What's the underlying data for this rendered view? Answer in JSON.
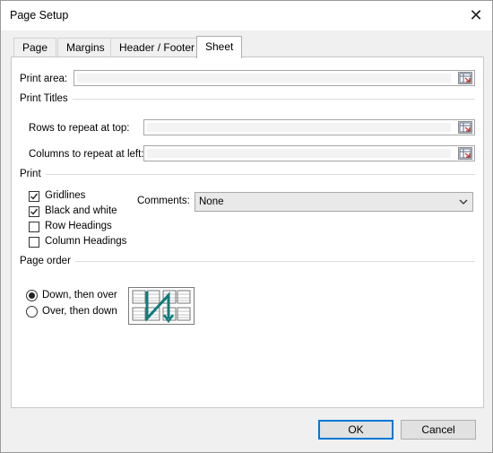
{
  "window": {
    "title": "Page Setup",
    "close_glyph": "✕"
  },
  "tabs": [
    {
      "label": "Page",
      "active": false
    },
    {
      "label": "Margins",
      "active": false
    },
    {
      "label": "Header / Footer",
      "active": false
    },
    {
      "label": "Sheet",
      "active": true
    }
  ],
  "sheet": {
    "print_area_label": "Print area:",
    "print_area_value": "",
    "print_titles_label": "Print Titles",
    "rows_repeat_label": "Rows to repeat at top:",
    "rows_repeat_value": "",
    "cols_repeat_label": "Columns to repeat at left:",
    "cols_repeat_value": "",
    "print_label": "Print",
    "options": [
      {
        "label": "Gridlines",
        "checked": true
      },
      {
        "label": "Black and white",
        "checked": true
      },
      {
        "label": "Row Headings",
        "checked": false
      },
      {
        "label": "Column Headings",
        "checked": false
      }
    ],
    "comments_label": "Comments:",
    "comments_value": "None",
    "page_order_label": "Page order",
    "page_order_options": [
      {
        "label": "Down, then over",
        "selected": true
      },
      {
        "label": "Over, then down",
        "selected": false
      }
    ],
    "icons": {
      "range_picker": "range-picker-icon",
      "dropdown": "chevron-down-icon",
      "page_order_preview": "page-order-preview-icon"
    }
  },
  "buttons": {
    "ok": "OK",
    "cancel": "Cancel"
  },
  "colors": {
    "accent": "#0078d7",
    "order_arrow": "#0e7c7b",
    "dialog_bg": "#f0f0f0",
    "panel_bg": "#ffffff"
  }
}
